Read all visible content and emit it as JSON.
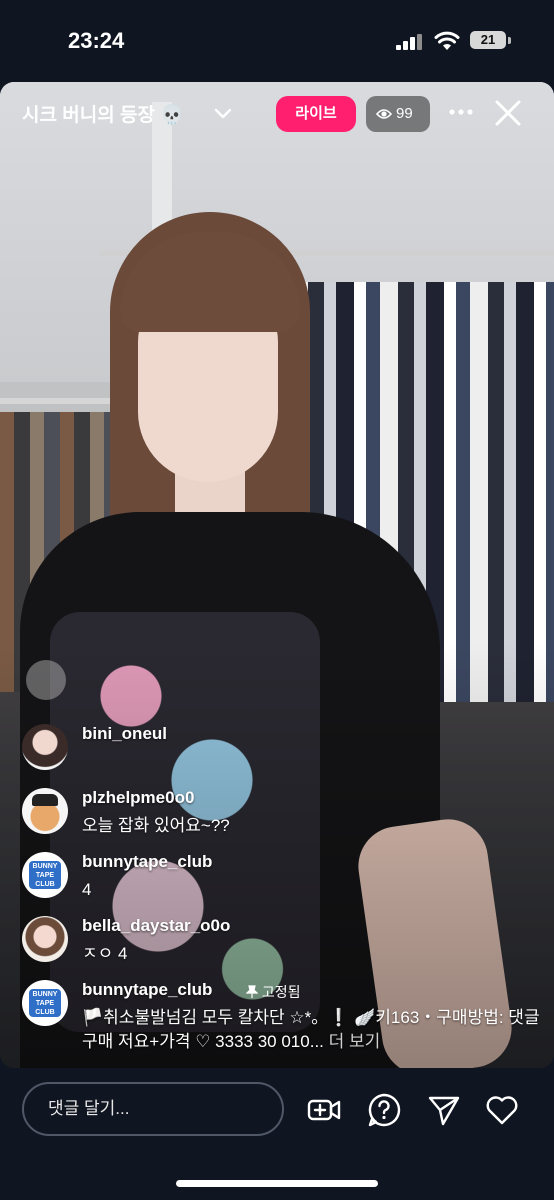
{
  "status_bar": {
    "time": "23:24",
    "battery": "21"
  },
  "header": {
    "title": "시크 버니의 등장 💀",
    "live_badge": "라이브",
    "viewer_count": "99"
  },
  "comments": [
    {
      "username": "bini_oneul",
      "text": ""
    },
    {
      "username": "plzhelpme0o0",
      "text": "오늘 잡화 있어요~??"
    },
    {
      "username": "bunnytape_club",
      "text": "4"
    },
    {
      "username": "bella_daystar_o0o",
      "text": "ㅈㅇ 4"
    },
    {
      "username": "bunnytape_club",
      "pinned_label": "고정됨",
      "text": "🏳️취소불발넘김 모두 칼차단 ☆*。❕ 🪽키163・구매방법: 댓글구매 저요+가격 ♡ 3333 30 010...",
      "more_label": "더 보기"
    }
  ],
  "avatar_logo_text": "BUNNY TAPE CLUB",
  "bottom_bar": {
    "comment_placeholder": "댓글 달기...",
    "icons": [
      "add-video-icon",
      "question-icon",
      "send-icon",
      "heart-icon"
    ]
  },
  "colors": {
    "live_badge": "#ff1f6e",
    "background": "#0f1521"
  }
}
